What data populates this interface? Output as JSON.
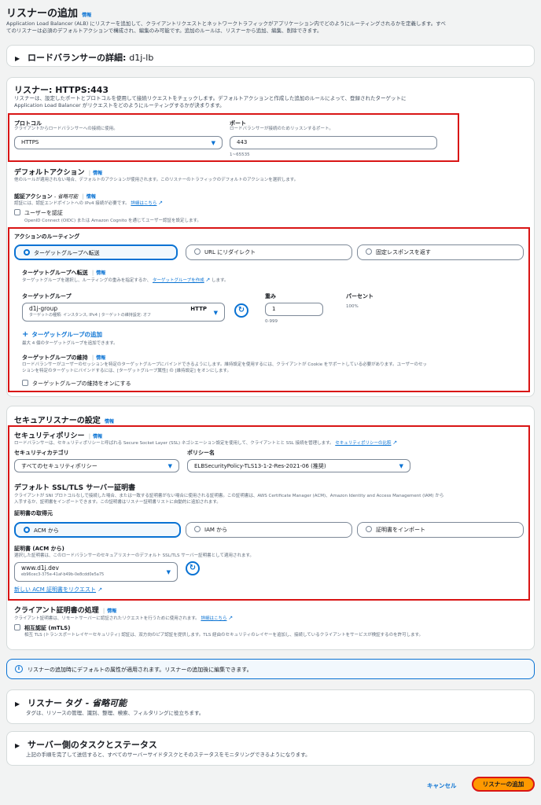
{
  "page": {
    "title": "リスナーの追加",
    "info": "情報",
    "desc1": "Application Load Balancer (ALB) にリスナーを追加して、クライアントリクエストとネットワークトラフィックがアプリケーション内でどのようにルーティングされるかを定義します。すべ",
    "desc2": "てのリスナーは必須のデフォルトアクションで構成され、編集のみ可能です。追加のルールは、リスナーから追加、編集、削除できます。"
  },
  "lb_details": {
    "label": "ロードバランサーの詳細:",
    "name": "d1j-lb"
  },
  "listener": {
    "title": "リスナー: HTTPS:443",
    "desc1": "リスナーは、設定したポートとプロトコルを使用して接続リクエストをチェックします。デフォルトアクションと作成した追加のルールによって、登録されたターゲットに",
    "desc2": "Application Load Balancer がリクエストをどのようにルーティングするかが決まります。",
    "protocol_label": "プロトコル",
    "protocol_desc": "クライアントからロードバランサーへの接続に使用。",
    "protocol_value": "HTTPS",
    "port_label": "ポート",
    "port_desc": "ロードバランサーが接続のためリッスンするポート。",
    "port_value": "443",
    "port_hint": "1~65535",
    "default_action_title": "デフォルトアクション",
    "default_action_desc": "他のルールが適用されない場合、デフォルトのアクションが使用されます。このリスナーのトラフィックのデフォルトのアクションを選択します。",
    "auth_label": "認証アクション",
    "auth_optional": "- 省略可能",
    "auth_desc": "認証には、認証エンドポイントへの IPv4 接続が必要です。",
    "auth_link": "詳細はこちら",
    "user_auth": "ユーザーを認証",
    "user_auth_desc": "OpenID Connect (OIDC) または Amazon Cognito を通じてユーザー認証を設定します。",
    "routing_title": "アクションのルーティング",
    "routing_options": [
      "ターゲットグループへ転送",
      "URL にリダイレクト",
      "固定レスポンスを返す"
    ],
    "forward_title": "ターゲットグループへ転送",
    "forward_desc": "ターゲットグループを選択し、ルーティングの重みを指定するか、",
    "forward_link": "ターゲットグループを作成",
    "forward_desc_end": "します。",
    "tg_label": "ターゲットグループ",
    "tg_name": "d1j-group",
    "tg_protocol": "HTTP",
    "tg_desc": "ターゲットの種類: インスタンス, IPv4 | ターゲットの維持設定: オフ",
    "weight_label": "重み",
    "weight_value": "1",
    "weight_hint": "0-999",
    "percent_label": "パーセント",
    "percent_value": "100%",
    "add_tg": "ターゲットグループの追加",
    "add_tg_desc": "最大 4 個のターゲットグループを追加できます。",
    "stickiness_title": "ターゲットグループの維持",
    "stickiness_desc1": "ロードバランサーがユーザーのセッションを特定のターゲットグループにバインドできるようにします。維持設定を使用するには、クライアントが Cookie をサポートしている必要があります。ユーザーのセッ",
    "stickiness_desc2": "ションを特定のターゲットにバインドするには、[ターゲットグループ属性] の [維持設定] をオンにします。",
    "stickiness_cb": "ターゲットグループの維持をオンにする"
  },
  "secure": {
    "title": "セキュアリスナーの設定",
    "policy_title": "セキュリティポリシー",
    "policy_desc": "ロードバランサーは、セキュリティポリシーと呼ばれる Secure Socket Layer (SSL) ネゴシエーション設定を使用して、クライアントとと SSL 接続を管理します。",
    "policy_link": "セキュリティポリシーの比較",
    "category_label": "セキュリティカテゴリ",
    "category_value": "すべてのセキュリティポリシー",
    "policy_name_label": "ポリシー名",
    "policy_name_value": "ELBSecurityPolicy-TLS13-1-2-Res-2021-06 (推奨)",
    "cert_title": "デフォルト SSL/TLS サーバー証明書",
    "cert_desc1": "クライアントが SNI プロトコルなしで接続した場合、または一致する証明書がない場合に使用される証明書。この証明書は、AWS Certificate Manager (ACM)、Amazon Identity and Access Management (IAM) から",
    "cert_desc2": "入手するか、証明書をインポートできます。この証明書はリスナー証明書リストに自動的に追加されます。",
    "source_label": "証明書の取得元",
    "source_options": [
      "ACM から",
      "IAM から",
      "証明書をインポート"
    ],
    "acm_label": "証明書 (ACM から)",
    "acm_desc": "選択した証明書は、このロードバランサーのセキュアリスナーのデフォルト SSL/TLS サーバー証明書として適用されます。",
    "acm_value": "www.d1j.dev",
    "acm_id": "eb96cec3-375e-41af-b49b-0e8cdd0e5a75",
    "acm_request": "新しい ACM 証明書をリクエスト",
    "client_cert_title": "クライアント証明書の処理",
    "client_cert_desc": "クライアント証明書は、リモートサーバーに認証されたリクエストを行うために使用されます。",
    "client_cert_link": "詳細はこちら",
    "mtls_label": "相互認証 (mTLS)",
    "mtls_desc": "相互 TLS (トランスポートレイヤーセキュリティ) 認証は、双方向のピア認証を提供します。TLS 経由のセキュリティのレイヤーを追加し、接続しているクライアントをサービスが検証するのを許可します。"
  },
  "notice": "リスナーの追加時にデフォルトの属性が適用されます。リスナーの追加後に編集できます。",
  "tags": {
    "title": "リスナー タグ",
    "optional": "- 省略可能",
    "desc": "タグは、リソースの管理、識別、整理、検索、フィルタリングに役立ちます。"
  },
  "server_tasks": {
    "title": "サーバー側のタスクとステータス",
    "desc": "上記の手順を完了して送信すると、すべてのサーバーサイドタスクとそのステータスをモニタリングできるようになります。"
  },
  "footer": {
    "cancel": "キャンセル",
    "submit": "リスナーの追加"
  },
  "colors": {
    "accent": "#0972d3",
    "primary_button": "#ff9900",
    "highlight": "#d91515"
  }
}
